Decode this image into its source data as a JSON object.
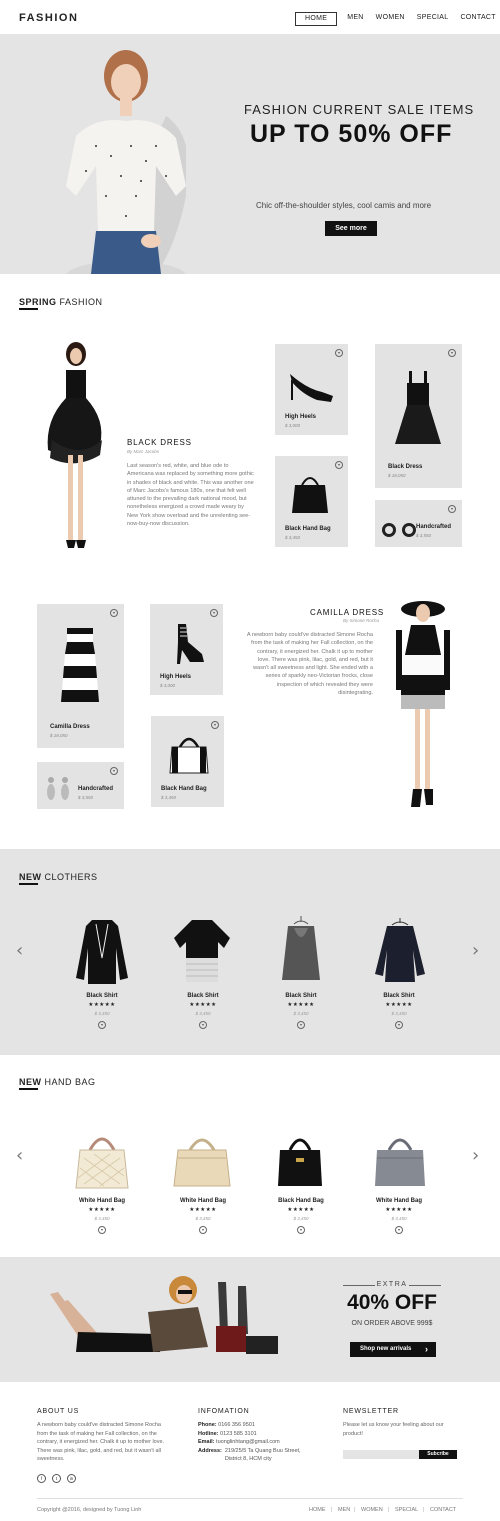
{
  "header": {
    "logo": "FASHION",
    "nav": [
      "HOME",
      "MEN",
      "WOMEN",
      "SPECIAL",
      "CONTACT"
    ]
  },
  "hero": {
    "subtitle": "FASHION CURRENT SALE ITEMS",
    "title": "UP TO 50% OFF",
    "description": "Chic off-the-shoulder styles, cool camis and more",
    "button": "See more"
  },
  "spring": {
    "title_bold": "SPRING",
    "title_rest": " FASHION",
    "feature1": {
      "title": "BLACK DRESS",
      "author": "By Marc Jacobs",
      "text": "Last season's red, white, and blue ode to Americana was replaced by something more gothic in shades of black and white. This was another one of Marc Jacobs's famous 180s, one that felt well attuned to the prevailing dark national mood, but nonetheless energized a crowd made weary by New York show overload and the unrelenting see-now-buy-now discussion."
    },
    "feature2": {
      "title": "CAMILLA DRESS",
      "author": "By Simone Rocha",
      "text": "A newborn baby could've distracted Simone Rocha from the task of making her Fall collection, on the contrary, it energized her. Chalk it up to mother love. There was pink, lilac, gold, and red, but it wasn't all sweetness and light. She ended with a series of sparkly neo-Victorian frocks, close inspection of which revealed they were disintegrating."
    },
    "cards": [
      {
        "name": "High Heels",
        "price": "$ 3,000"
      },
      {
        "name": "Black Dress",
        "price": "$ 18,050"
      },
      {
        "name": "Black Hand Bag",
        "price": "$ 3,450"
      },
      {
        "name": "Handcrafted",
        "price": "$ 3,550"
      },
      {
        "name": "Camilla Dress",
        "price": "$ 18,050"
      },
      {
        "name": "High Heels",
        "price": "$ 3,000"
      },
      {
        "name": "Black Hand Bag",
        "price": "$ 3,450"
      },
      {
        "name": "Handcrafted",
        "price": "$ 3,550"
      }
    ]
  },
  "clothers": {
    "title_bold": "NEW",
    "title_rest": " CLOTHERS",
    "items": [
      {
        "name": "Black Shirt",
        "stars": "★★★★★",
        "price": "$ 3,450"
      },
      {
        "name": "Black Shirt",
        "stars": "★★★★★",
        "price": "$ 3,450"
      },
      {
        "name": "Black Shirt",
        "stars": "★★★★★",
        "price": "$ 3,450"
      },
      {
        "name": "Black Shirt",
        "stars": "★★★★★",
        "price": "$ 3,450"
      }
    ],
    "prev": "‹",
    "next": "›"
  },
  "handbag": {
    "title_bold": "NEW",
    "title_rest": " HAND BAG",
    "items": [
      {
        "name": "White Hand Bag",
        "stars": "★★★★★",
        "price": "$ 3,450"
      },
      {
        "name": "White Hand Bag",
        "stars": "★★★★★",
        "price": "$ 3,450"
      },
      {
        "name": "Black Hand Bag",
        "stars": "★★★★★",
        "price": "$ 3,450"
      },
      {
        "name": "White Hand Bag",
        "stars": "★★★★★",
        "price": "$ 3,450"
      }
    ],
    "prev": "‹",
    "next": "›"
  },
  "promo": {
    "extra": "EXTRA",
    "big": "40% OFF",
    "small": "ON ORDER ABOVE 999$",
    "button": "Shop new arrivals",
    "button_arrow": "›"
  },
  "footer": {
    "about_title": "ABOUT US",
    "about_text": "A newborn baby could've distracted Simone Rocha from the task of making her Fall collection, on the contrary, it energized her. Chalk it up to mother love. There was pink, lilac, gold, and red, but it wasn't all sweetness.",
    "social": [
      "f",
      "t",
      "in"
    ],
    "info_title": "INFOMATION",
    "phone_label": "Phone:",
    "phone": "0166 356 9501",
    "hotline_label": "Hotline:",
    "hotline": "0123 585 3101",
    "email_label": "Email:",
    "email": "tuonglinhtang@gmail.com",
    "address_label": "Address:",
    "address": "219/25/5 Ta Quang Buu Street, District 8, HCM city",
    "newsletter_title": "NEWSLETTER",
    "newsletter_text": "Please let us know your feeling about our product!",
    "subscribe": "Subcribe",
    "copyright": "Copyright @2016, designed by Tuong Linh",
    "nav": [
      "HOME",
      "MEN",
      "WOMEN",
      "SPECIAL",
      "CONTACT"
    ]
  },
  "colors": {
    "accent": "#111111",
    "band": "#e4e4e4",
    "card": "#e3e3e3"
  }
}
